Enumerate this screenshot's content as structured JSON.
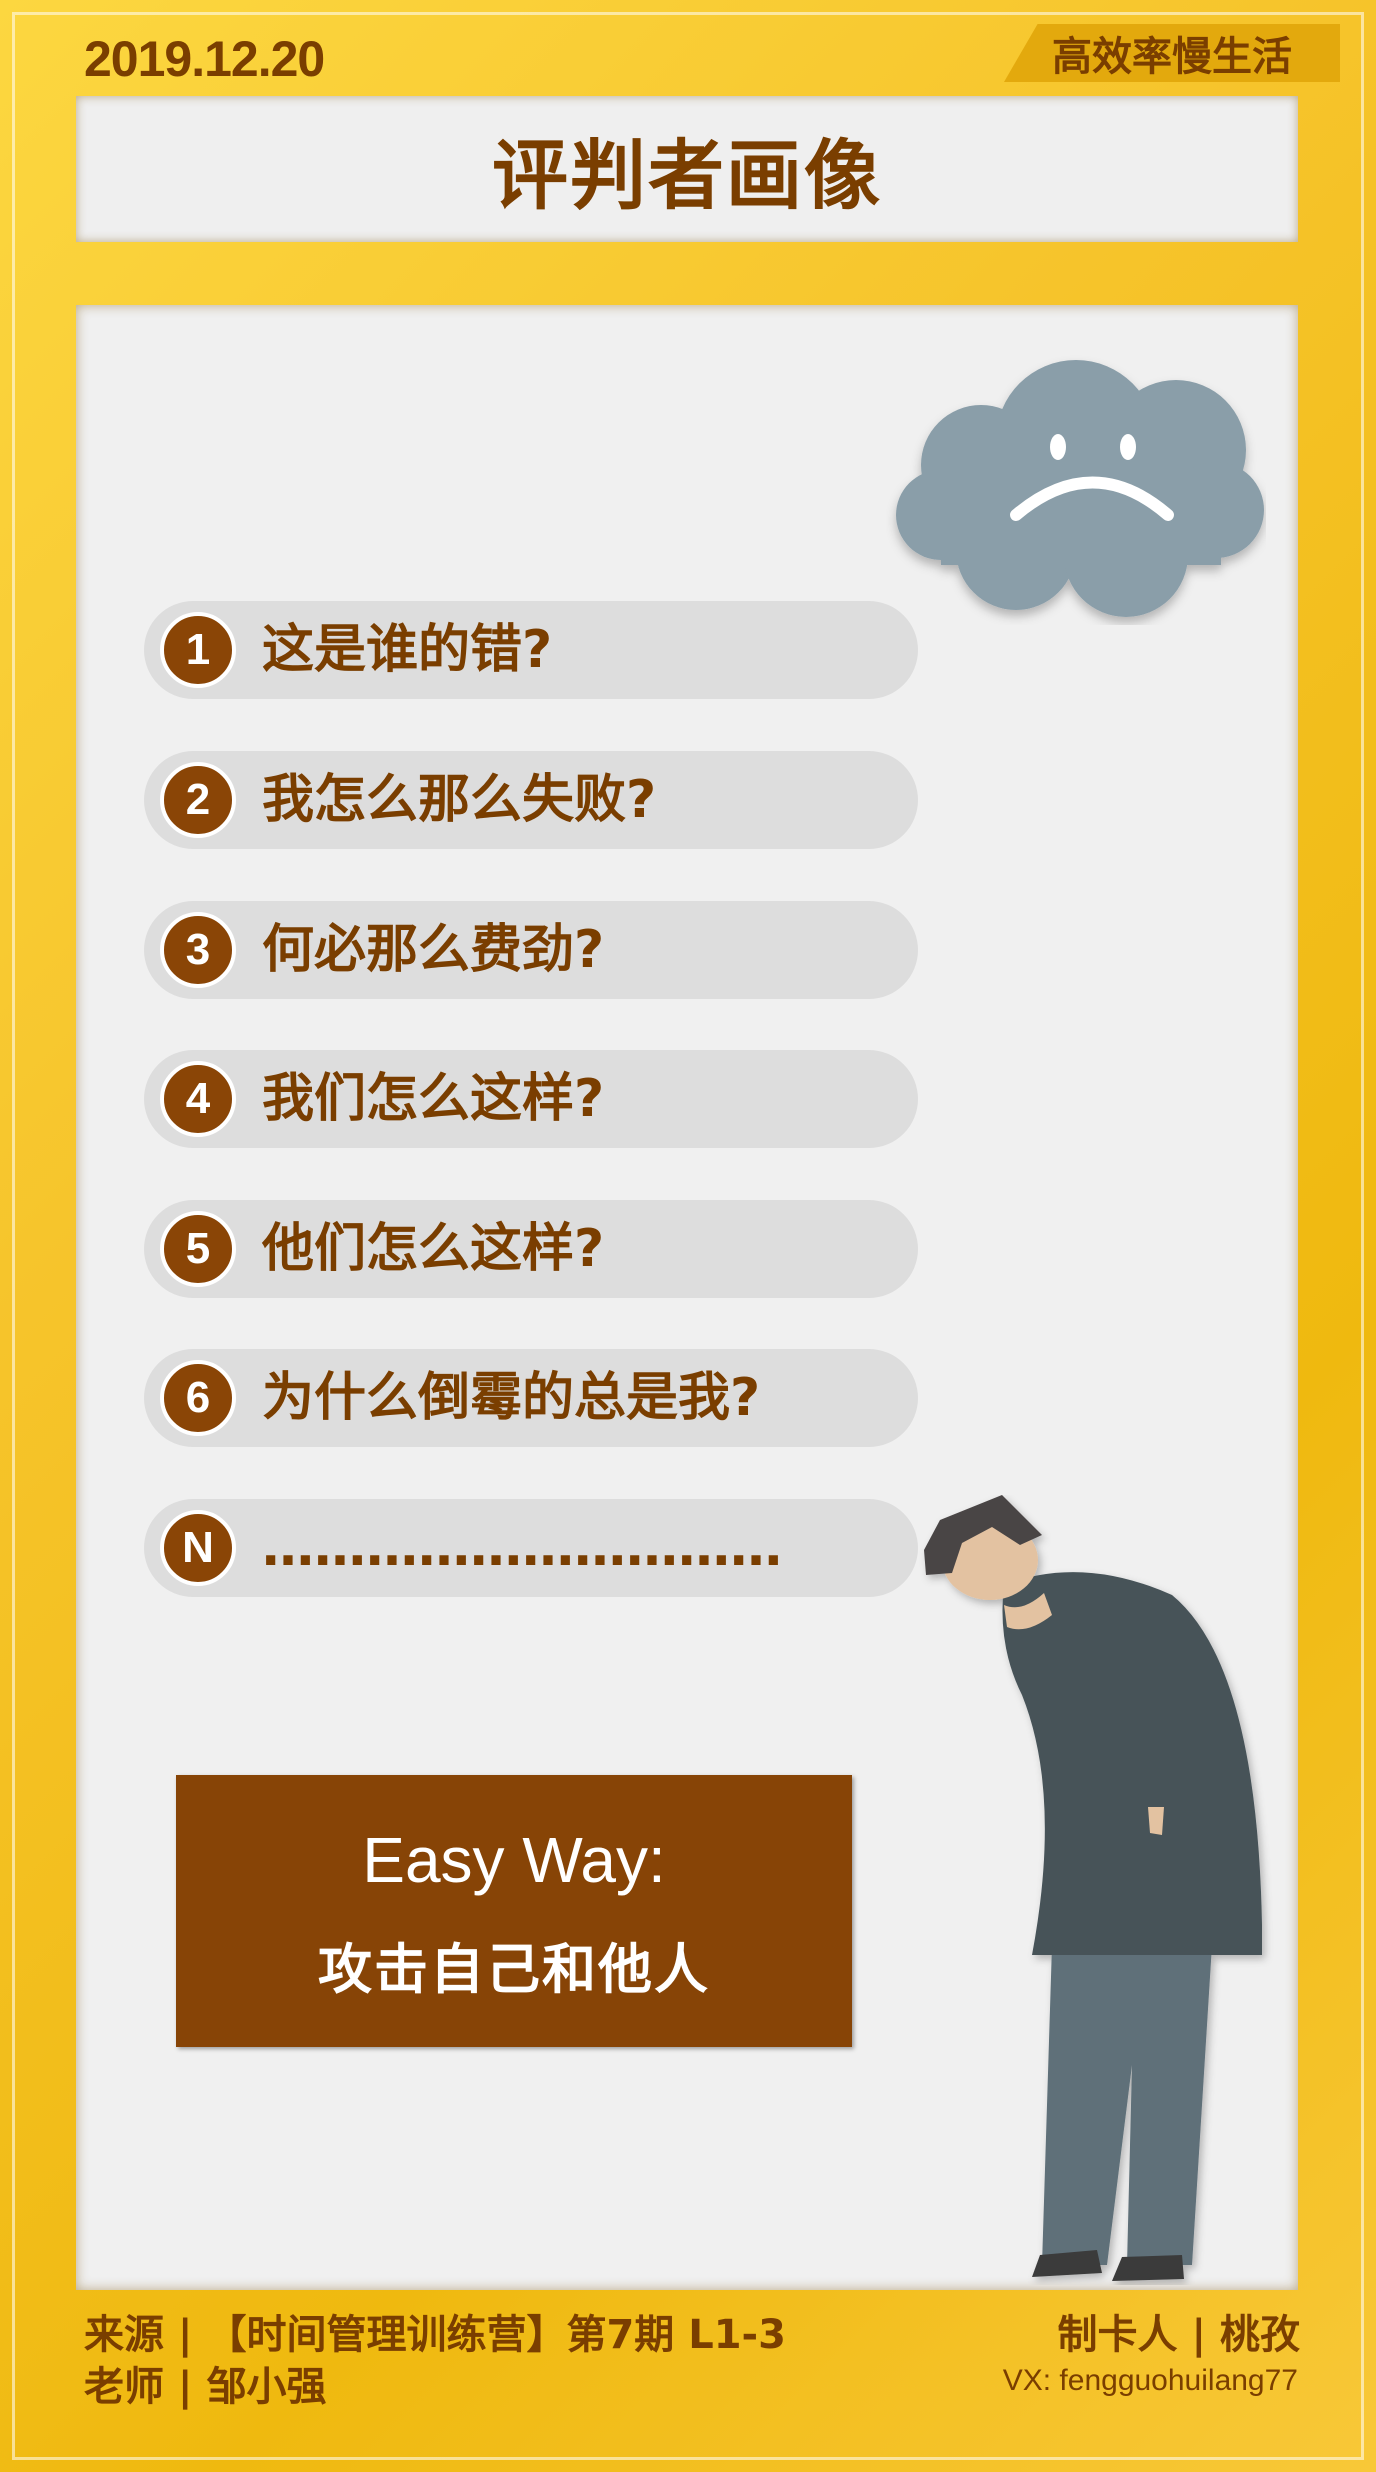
{
  "header": {
    "date": "2019.12.20",
    "brand": "高效率慢生活",
    "title": "评判者画像"
  },
  "questions": [
    {
      "num": "1",
      "text": "这是谁的错?"
    },
    {
      "num": "2",
      "text": "我怎么那么失败?"
    },
    {
      "num": "3",
      "text": "何必那么费劲?"
    },
    {
      "num": "4",
      "text": "我们怎么这样?"
    },
    {
      "num": "5",
      "text": "他们怎么这样?"
    },
    {
      "num": "6",
      "text": "为什么倒霉的总是我?"
    },
    {
      "num": "N",
      "text": "…………………………"
    }
  ],
  "easy_way": {
    "title": "Easy Way:",
    "subtitle": "攻击自己和他人"
  },
  "footer": {
    "source_line": "来源 | 【时间管理训练营】第7期 L1-3",
    "teacher_line": "老师 | 邹小强",
    "maker_line": "制卡人 | 桃孜",
    "vx_line": "VX: fengguohuilang77"
  },
  "colors": {
    "background": "#f6c42b",
    "accent_brown": "#874406",
    "text_brown": "#7a3e00",
    "panel": "#f0f0f0",
    "pill": "#dddddd",
    "cloud": "#8a9ea9"
  }
}
